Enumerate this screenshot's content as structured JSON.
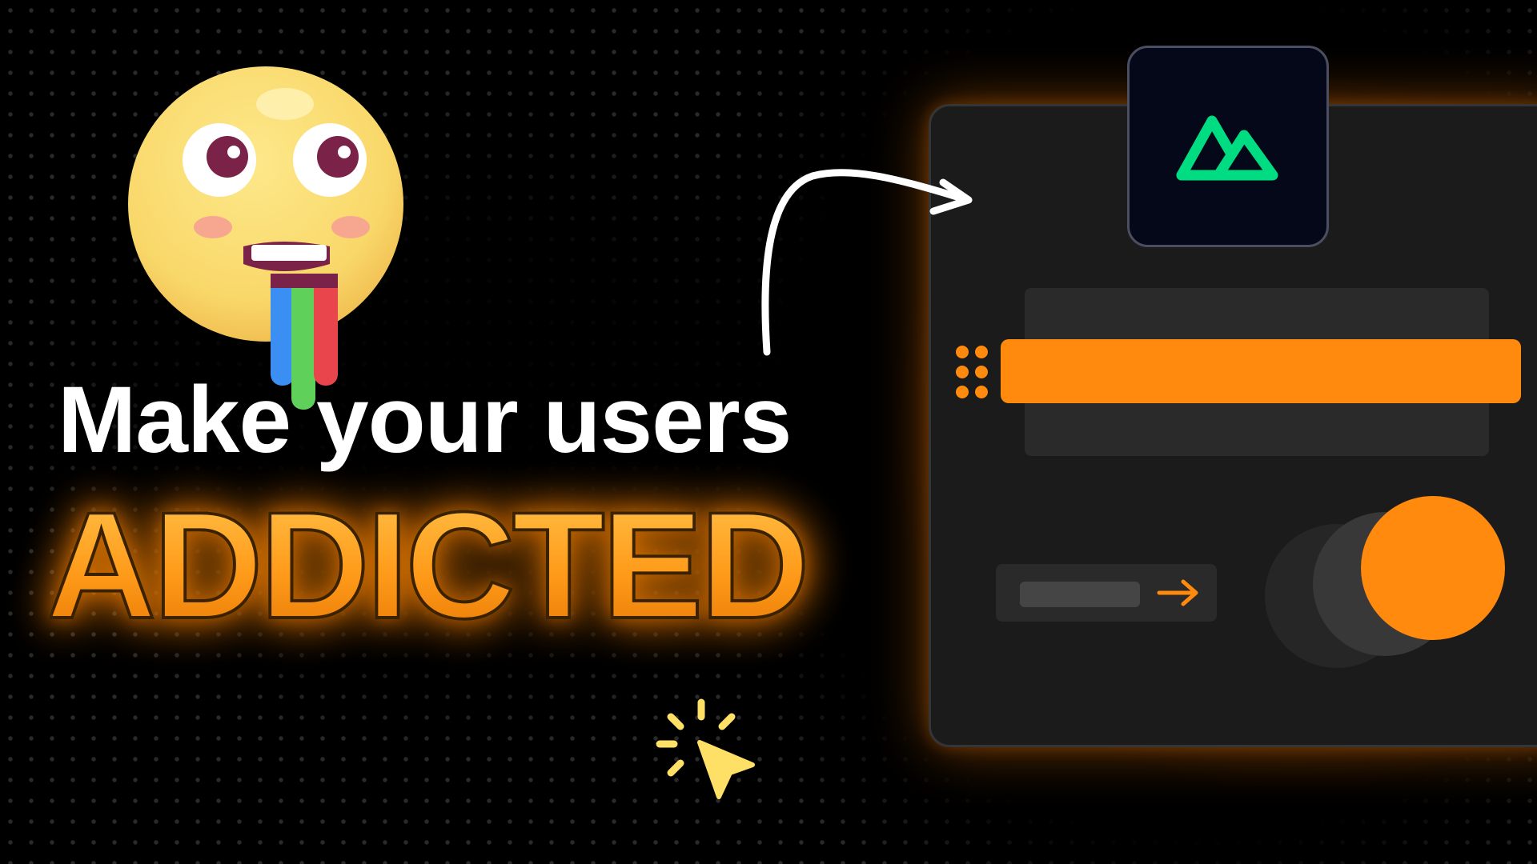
{
  "headline": {
    "line1": "Make your users",
    "line2": "ADDICTED"
  },
  "colors": {
    "background": "#000000",
    "accent_orange": "#ff8a0d",
    "panel": "#1b1b1b",
    "panel_border": "#353535",
    "logo_tile": "#050818",
    "logo_green": "#00dc82",
    "emoji_yellow": "#fbe27a",
    "cursor_yellow": "#ffe066"
  },
  "icons": {
    "emoji": "drooling-face-emoji-icon",
    "arrow": "curved-arrow-icon",
    "cursor": "click-cursor-icon",
    "logo": "nuxt-logo-icon",
    "drag_handle": "drag-handle-icon",
    "input_arrow": "arrow-right-icon"
  }
}
